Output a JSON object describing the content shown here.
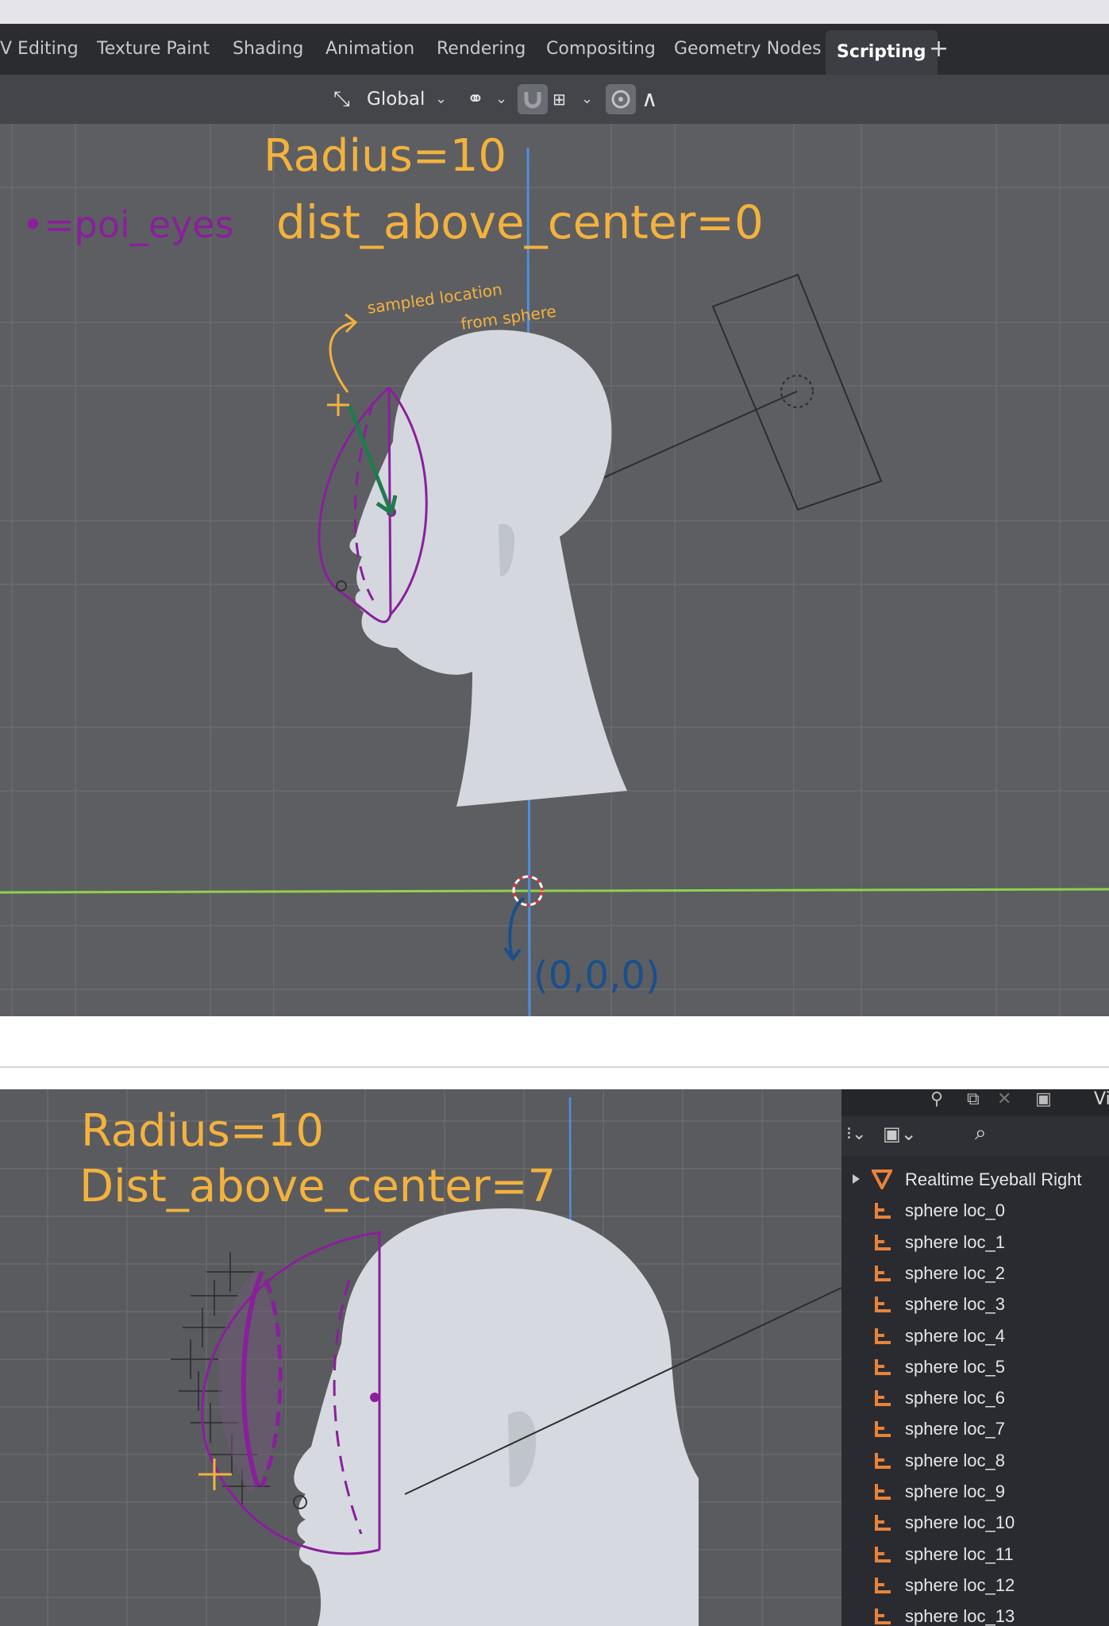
{
  "top": {
    "tabs": [
      {
        "label": "V Editing"
      },
      {
        "label": "Texture Paint"
      },
      {
        "label": "Shading"
      },
      {
        "label": "Animation"
      },
      {
        "label": "Rendering"
      },
      {
        "label": "Compositing"
      },
      {
        "label": "Geometry Nodes"
      },
      {
        "label": "Scripting"
      }
    ],
    "add_tab": "+",
    "active_tab": "Scripting",
    "header": {
      "transform_orientation": "Global"
    },
    "annotations": {
      "radius": "Radius=10",
      "legend": "•=poi_eyes",
      "dist": "dist_above_center=0",
      "sampled_line1": "sampled location",
      "sampled_line2": "from sphere",
      "origin": "(0,0,0)"
    }
  },
  "bottom": {
    "annotations": {
      "radius": "Radius=10",
      "dist": "Dist_above_center=7"
    },
    "outliner": {
      "items": [
        {
          "label": "Realtime Eyeball Right",
          "icon": "mesh-triangle-icon"
        },
        {
          "label": "sphere loc_0",
          "icon": "empty-axes-icon"
        },
        {
          "label": "sphere loc_1",
          "icon": "empty-axes-icon"
        },
        {
          "label": "sphere loc_2",
          "icon": "empty-axes-icon"
        },
        {
          "label": "sphere loc_3",
          "icon": "empty-axes-icon"
        },
        {
          "label": "sphere loc_4",
          "icon": "empty-axes-icon"
        },
        {
          "label": "sphere loc_5",
          "icon": "empty-axes-icon"
        },
        {
          "label": "sphere loc_6",
          "icon": "empty-axes-icon"
        },
        {
          "label": "sphere loc_7",
          "icon": "empty-axes-icon"
        },
        {
          "label": "sphere loc_8",
          "icon": "empty-axes-icon"
        },
        {
          "label": "sphere loc_9",
          "icon": "empty-axes-icon"
        },
        {
          "label": "sphere loc_10",
          "icon": "empty-axes-icon"
        },
        {
          "label": "sphere loc_11",
          "icon": "empty-axes-icon"
        },
        {
          "label": "sphere loc_12",
          "icon": "empty-axes-icon"
        },
        {
          "label": "sphere loc_13",
          "icon": "empty-axes-icon"
        }
      ],
      "view_label": "Vi"
    }
  },
  "colors": {
    "annotation_orange": "#f3b23d",
    "annotation_purple": "#8a1f9c",
    "annotation_green": "#1f7a4c",
    "annotation_blue": "#1a4f8c",
    "axis_green": "#8fd14f",
    "axis_blue": "#4f8fe0",
    "icon_orange": "#e8833a"
  }
}
